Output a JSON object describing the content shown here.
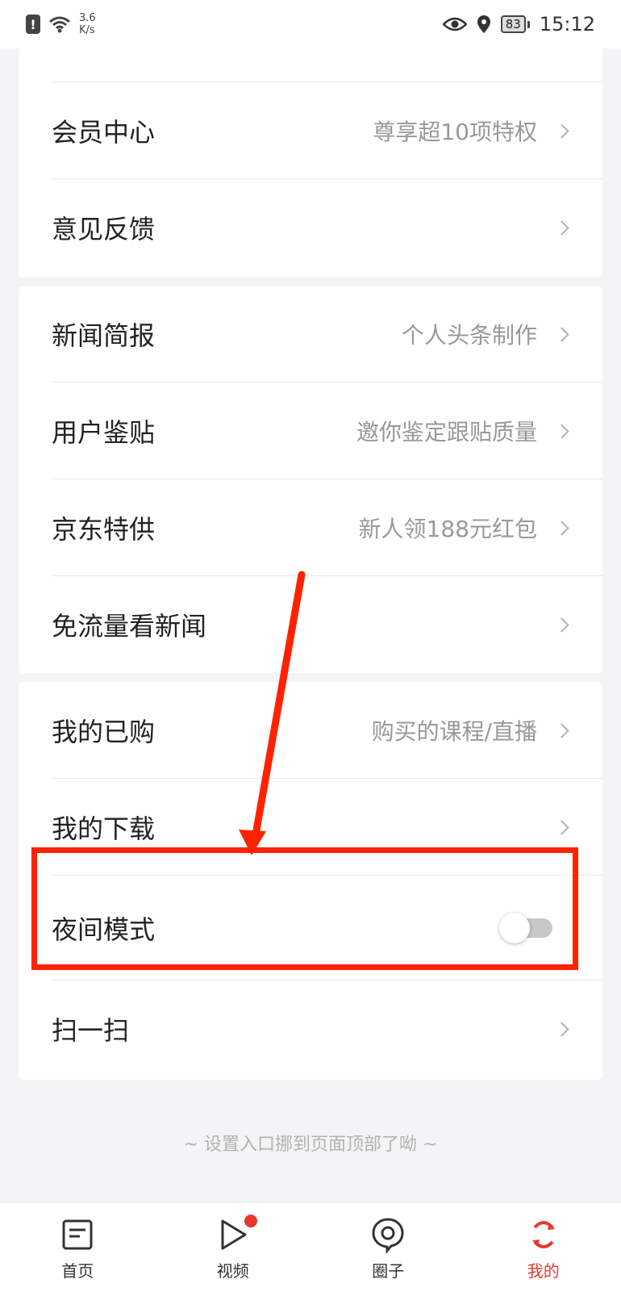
{
  "status_bar": {
    "net_speed_value": "3.6",
    "net_speed_unit": "K/s",
    "battery": "83",
    "time": "15:12",
    "icons": [
      "alert-icon",
      "wifi-icon",
      "eye-icon",
      "location-icon",
      "battery-icon"
    ]
  },
  "sections": [
    {
      "items": [
        {
          "label": "会员中心",
          "sub": "尊享超10项特权"
        },
        {
          "label": "意见反馈",
          "sub": ""
        }
      ]
    },
    {
      "items": [
        {
          "label": "新闻简报",
          "sub": "个人头条制作"
        },
        {
          "label": "用户鉴贴",
          "sub": "邀你鉴定跟贴质量"
        },
        {
          "label": "京东特供",
          "sub": "新人领188元红包"
        },
        {
          "label": "免流量看新闻",
          "sub": ""
        }
      ]
    },
    {
      "items": [
        {
          "label": "我的已购",
          "sub": "购买的课程/直播"
        },
        {
          "label": "我的下载",
          "sub": ""
        },
        {
          "label": "夜间模式",
          "toggle": "off"
        },
        {
          "label": "扫一扫",
          "sub": ""
        }
      ]
    }
  ],
  "footer_note": "~ 设置入口挪到页面顶部了呦 ~",
  "tabs": [
    {
      "label": "首页",
      "icon": "news-icon"
    },
    {
      "label": "视频",
      "icon": "play-icon"
    },
    {
      "label": "圈子",
      "icon": "circle-icon"
    },
    {
      "label": "我的",
      "icon": "profile-icon"
    }
  ],
  "colors": {
    "accent": "#e8382f",
    "annotation": "#ff2200",
    "background": "#f4f4f6"
  }
}
